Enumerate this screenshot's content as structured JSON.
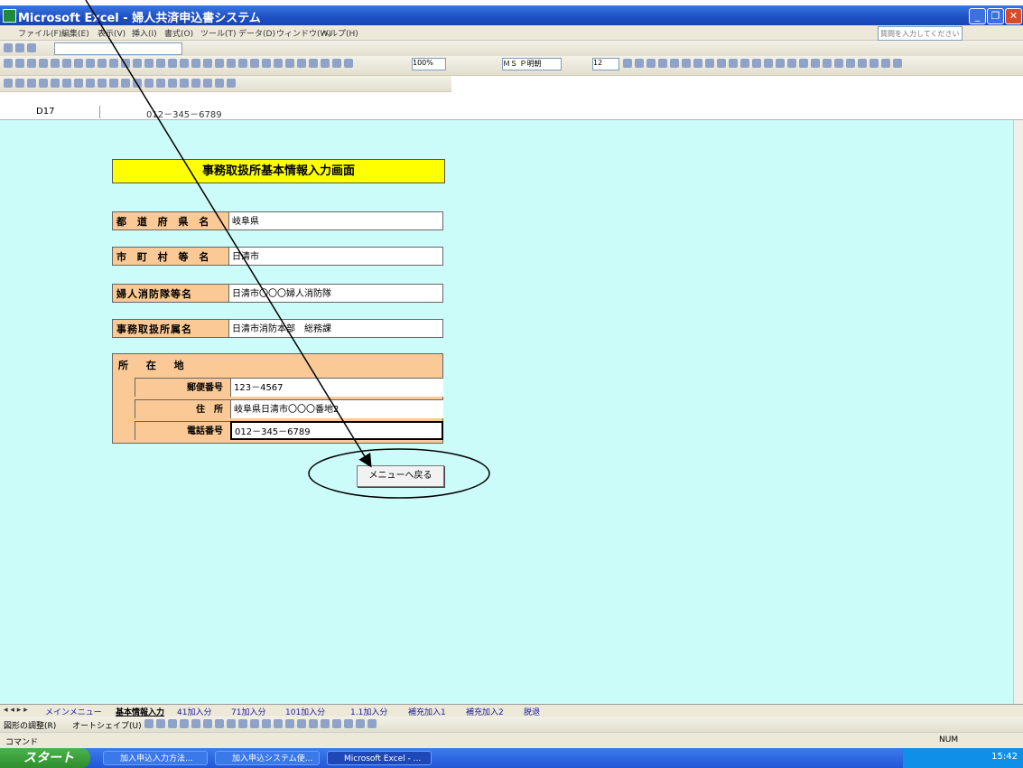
{
  "window": {
    "title": "Microsoft Excel - 婦人共済申込書システム"
  },
  "menubar": {
    "items": [
      "ファイル(F)",
      "編集(E)",
      "表示(V)",
      "挿入(I)",
      "書式(O)",
      "ツール(T)",
      "データ(D)",
      "ウィンドウ(W)",
      "ヘルプ(H)"
    ],
    "help_placeholder": "質問を入力してください"
  },
  "toolbar": {
    "zoom": "100%",
    "font_name": "ＭＳ Ｐ明朝",
    "font_size": "12"
  },
  "formula_bar": {
    "cell_ref": "D17",
    "value": "012－345－6789"
  },
  "form": {
    "title": "事務取扱所基本情報入力画面",
    "fields": [
      {
        "label": "都 道 府 県 名",
        "value": "岐阜県"
      },
      {
        "label": "市 町 村 等 名",
        "value": "日清市"
      },
      {
        "label": "婦人消防隊等名",
        "value": "日清市〇〇〇婦人消防隊"
      },
      {
        "label": "事務取扱所属名",
        "value": "日清市消防本部　総務課"
      }
    ],
    "address": {
      "label": "所 在 地",
      "rows": [
        {
          "label": "郵便番号",
          "value": "123－4567"
        },
        {
          "label": "住　所",
          "value": "岐阜県日清市〇〇〇番地2"
        },
        {
          "label": "電話番号",
          "value": "012－345－6789"
        }
      ]
    },
    "menu_button": "メニューへ戻る"
  },
  "sheet_tabs": [
    "メインメニュー",
    "基本情報入力",
    "41加入分",
    "71加入分",
    "101加入分",
    "1.1加入分",
    "補充加入1",
    "補充加入2",
    "脱退"
  ],
  "active_tab": "基本情報入力",
  "drawbar": {
    "draw": "図形の調整(R)",
    "autoshape": "オートシェイプ(U)"
  },
  "statusbar": {
    "text": "コマンド",
    "num": "NUM"
  },
  "taskbar": {
    "start": "スタート",
    "tasks": [
      "加入申込入力方法...",
      "加入申込システム使...",
      "Microsoft Excel - ..."
    ],
    "clock": "15:42"
  },
  "colors": {
    "sheet_bg": "#ccfcfa",
    "label_bg": "#fbc995",
    "title_bg": "#ffff00"
  }
}
